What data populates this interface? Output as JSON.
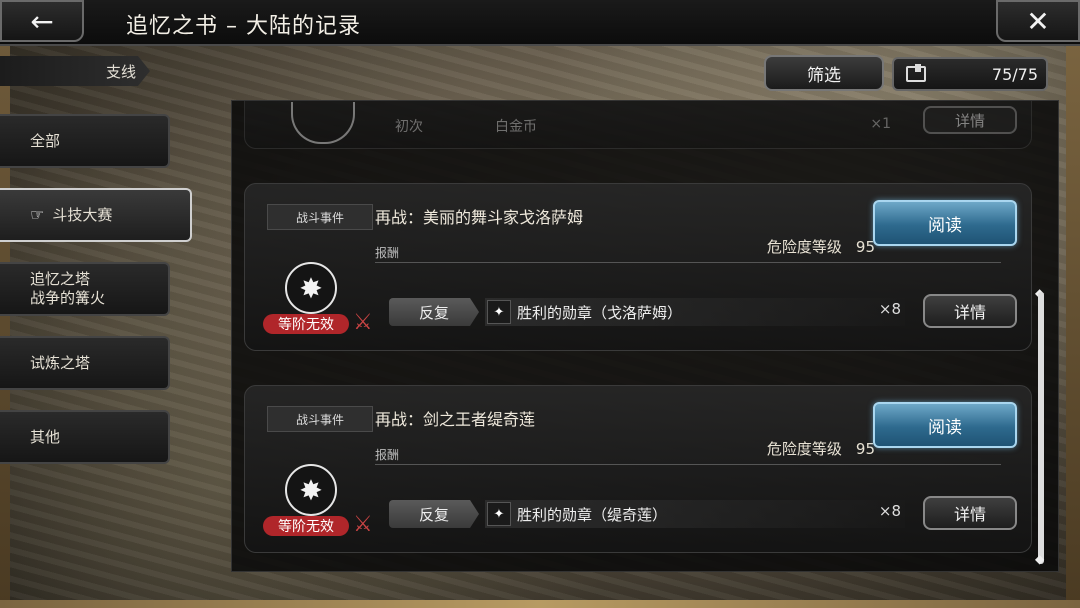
{
  "header": {
    "title": "追忆之书 – 大陆的记录",
    "back_icon": "back-arrow-icon",
    "close_icon": "close-icon"
  },
  "sidebar": {
    "subline_label": "支线",
    "tabs": [
      {
        "label": "全部",
        "active": false
      },
      {
        "label": "斗技大赛",
        "active": true
      },
      {
        "label": "追忆之塔\n战争的篝火",
        "active": false
      },
      {
        "label": "试炼之塔",
        "active": false
      },
      {
        "label": "其他",
        "active": false
      }
    ]
  },
  "toolbar": {
    "filter_label": "筛选",
    "counter": "75/75"
  },
  "partial_card": {
    "first_label": "初次",
    "coin_label": "白金币",
    "qty": "×1",
    "detail_label": "详情"
  },
  "cards": [
    {
      "tag": "战斗事件",
      "title": "再战：美丽的舞斗家戈洛萨姆",
      "reward_label": "报酬",
      "danger_label": "危险度等级",
      "danger_value": "95",
      "read_label": "阅读",
      "invalid_label": "等阶无效",
      "repeat_label": "反复",
      "item_name": "胜利的勋章（戈洛萨姆）",
      "qty": "×8",
      "detail_label": "详情"
    },
    {
      "tag": "战斗事件",
      "title": "再战：剑之王者缇奇莲",
      "reward_label": "报酬",
      "danger_label": "危险度等级",
      "danger_value": "95",
      "read_label": "阅读",
      "invalid_label": "等阶无效",
      "repeat_label": "反复",
      "item_name": "胜利的勋章（缇奇莲）",
      "qty": "×8",
      "detail_label": "详情"
    }
  ],
  "colors": {
    "read_button": "#2e6a8e",
    "invalid_badge": "#b0262a",
    "panel_bg": "#0a0a0a"
  }
}
